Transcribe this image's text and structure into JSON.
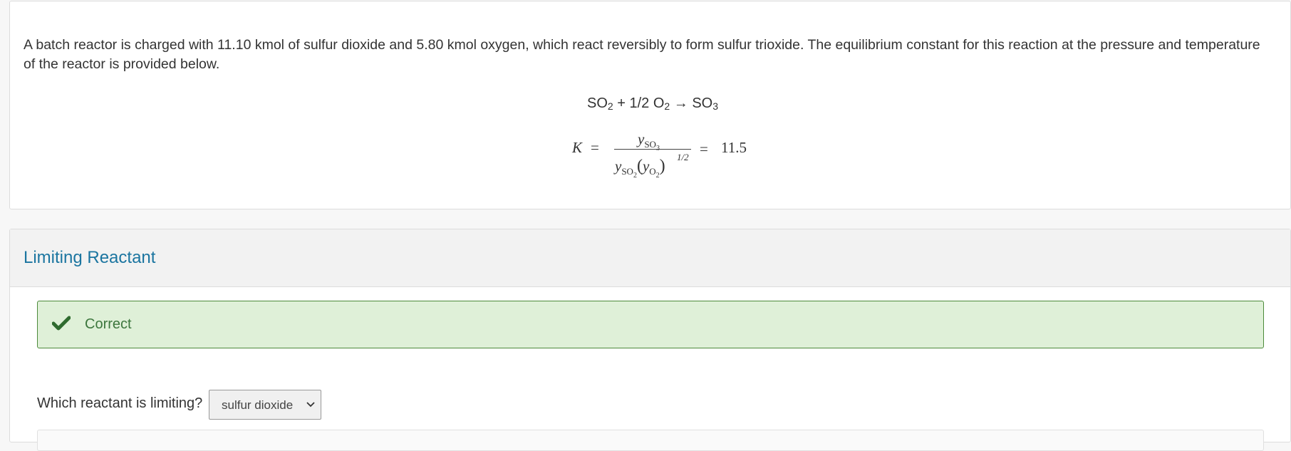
{
  "problem": {
    "text": "A batch reactor is charged with 11.10 kmol of sulfur dioxide and 5.80 kmol oxygen, which react reversibly to form sulfur trioxide.  The equilibrium constant for this reaction at the pressure and temperature of the reactor is provided below.",
    "reaction": {
      "so2": "SO",
      "so2_sub": "2",
      "plus_half": " + 1/2 O",
      "o2_sub": "2",
      "arrow": " → SO",
      "so3_sub": "3"
    },
    "equation": {
      "k_symbol": "K",
      "equals": "=",
      "num_y": "y",
      "num_sub": "SO",
      "num_subsub": "3",
      "den_y1": "y",
      "den_sub1": "SO",
      "den_subsub1": "2",
      "den_open": "(",
      "den_y2": "y",
      "den_sub2": "O",
      "den_subsub2": "2",
      "den_close": ")",
      "exponent": "1/2",
      "equals2": "=",
      "value": "11.5"
    }
  },
  "section": {
    "title": "Limiting Reactant",
    "feedback": {
      "icon": "check-icon",
      "text": "Correct",
      "color": "#3c763d",
      "background": "#dff0d8"
    },
    "question": {
      "label": "Which reactant is limiting?",
      "selected": "sulfur dioxide"
    }
  },
  "colors": {
    "accent": "#1b75a0",
    "success": "#3c763d"
  }
}
